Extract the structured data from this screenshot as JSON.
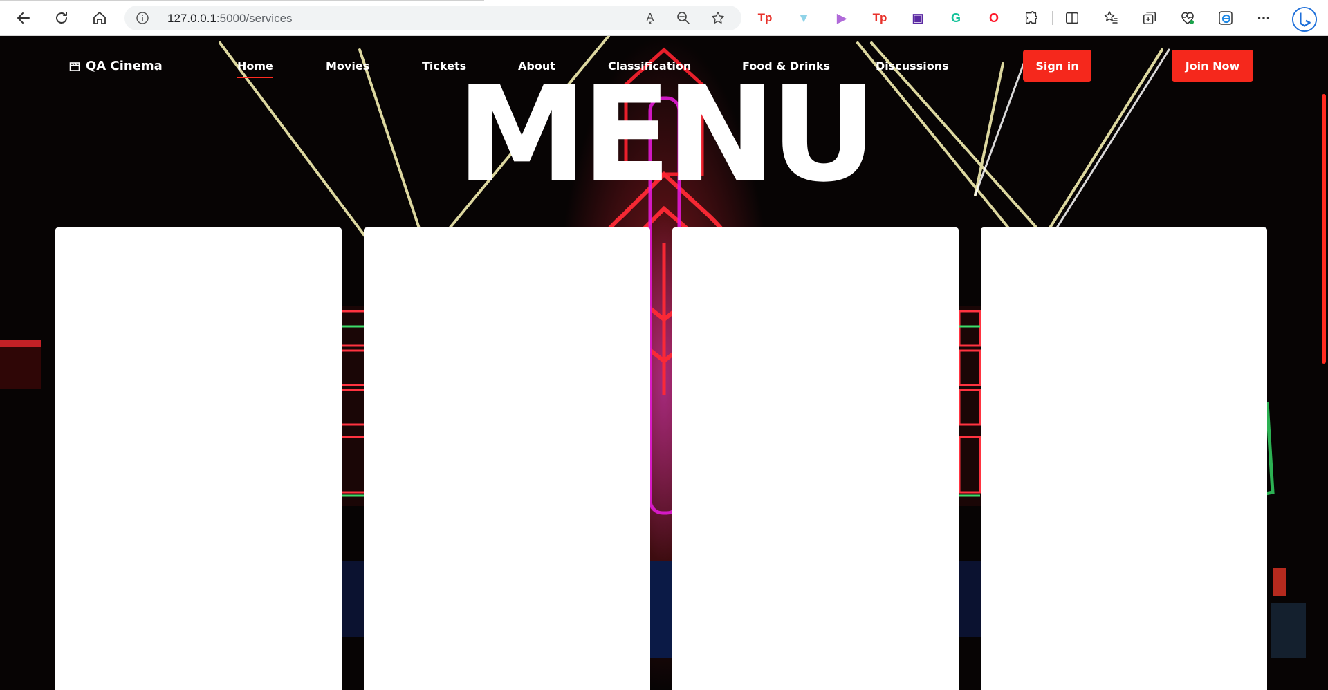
{
  "browser": {
    "url_host": "127.0.0.1",
    "url_path": ":5000/services",
    "read_aloud_glyph": "A͓",
    "extensions": [
      {
        "name": "tp-extension-1",
        "glyph": "Tp",
        "color": "#e8322b"
      },
      {
        "name": "shield-extension",
        "glyph": "▼",
        "color": "#8fd3e8"
      },
      {
        "name": "play-extension",
        "glyph": "▶",
        "color": "#b06ad9"
      },
      {
        "name": "tp-extension-2",
        "glyph": "Tp",
        "color": "#e8322b"
      },
      {
        "name": "purple-extension",
        "glyph": "▣",
        "color": "#5b2aa3"
      },
      {
        "name": "grammarly-extension",
        "glyph": "G",
        "color": "#15c39a"
      },
      {
        "name": "opera-extension",
        "glyph": "O",
        "color": "#ff1b2d"
      }
    ]
  },
  "site": {
    "brand": "QA Cinema",
    "nav": [
      "Home",
      "Movies",
      "Tickets",
      "About",
      "Classification",
      "Food & Drinks",
      "Discussions"
    ],
    "signin": "Sign in",
    "join": "Join Now",
    "hero_title": "MENU"
  },
  "colors": {
    "accent": "#f5281c",
    "card": "#ffffff"
  }
}
